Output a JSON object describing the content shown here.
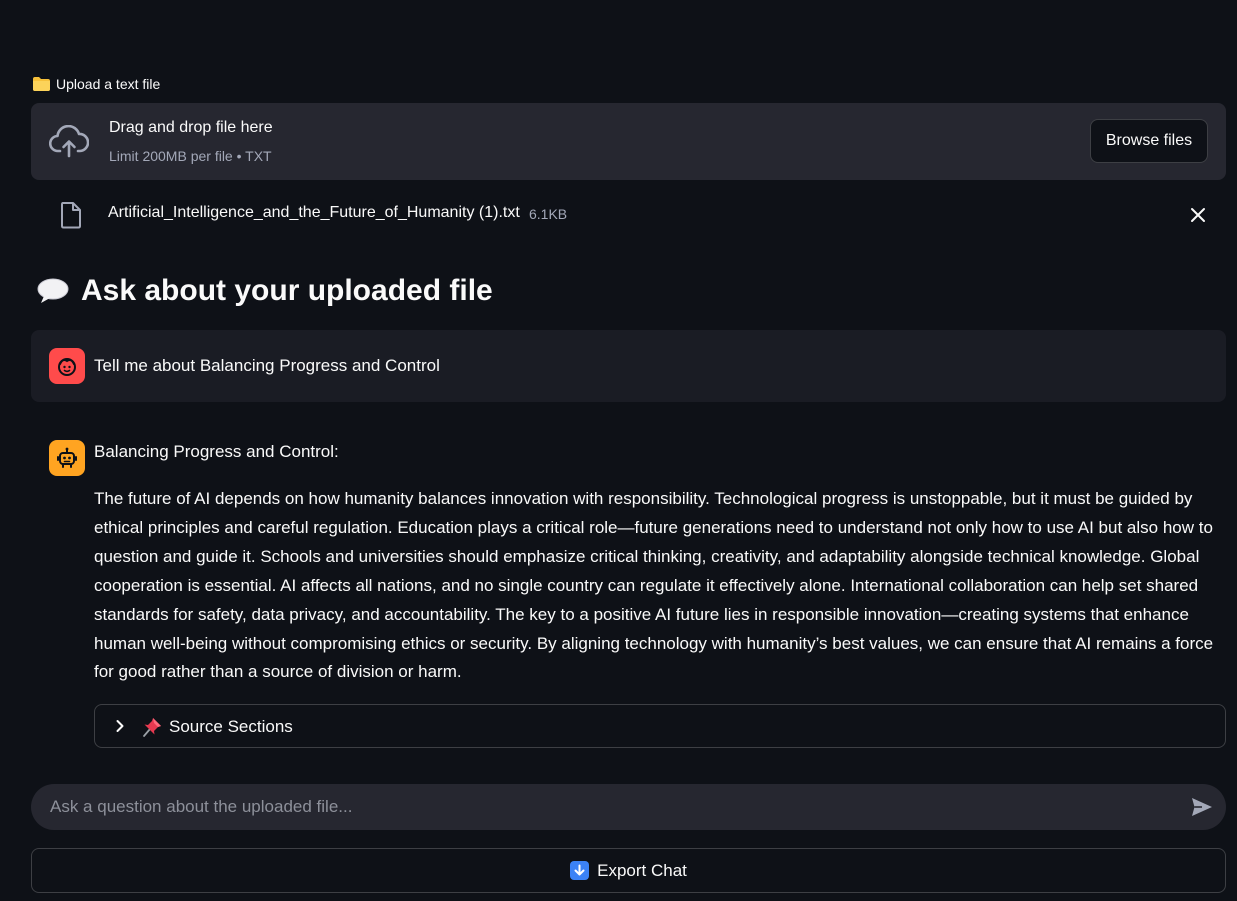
{
  "uploader": {
    "label": "Upload a text file",
    "drop_title": "Drag and drop file here",
    "drop_sub": "Limit 200MB per file • TXT",
    "browse_label": "Browse files"
  },
  "uploaded_file": {
    "name": "Artificial_Intelligence_and_the_Future_of_Humanity (1).txt",
    "size": "6.1KB"
  },
  "chat": {
    "heading": "Ask about your uploaded file",
    "messages": [
      {
        "role": "user",
        "text": "Tell me about Balancing Progress and Control"
      },
      {
        "role": "assistant",
        "title": "Balancing Progress and Control:",
        "body": "The future of AI depends on how humanity balances innovation with responsibility. Technological progress is unstoppable, but it must be guided by ethical principles and careful regulation. Education plays a critical role—future generations need to understand not only how to use AI but also how to question and guide it. Schools and universities should emphasize critical thinking, creativity, and adaptability alongside technical knowledge. Global cooperation is essential. AI affects all nations, and no single country can regulate it effectively alone. International collaboration can help set shared standards for safety, data privacy, and accountability. The key to a positive AI future lies in responsible innovation—creating systems that enhance human well-being without compromising ethics or security. By aligning technology with humanity’s best values, we can ensure that AI remains a force for good rather than a source of division or harm.",
        "expander_label": "Source Sections"
      }
    ],
    "input_placeholder": "Ask a question about the uploaded file...",
    "export_label": "Export Chat"
  },
  "colors": {
    "background": "#0e1117",
    "panel": "#262730",
    "user_avatar": "#ff4b4b",
    "assistant_avatar": "#ffa421"
  },
  "icons": {
    "uploader_label": "folder-icon",
    "dropzone": "cloud-upload-icon",
    "file": "file-icon",
    "remove_file": "close-icon",
    "heading": "speech-bubble-icon",
    "user": "user-avatar-icon",
    "assistant": "robot-avatar-icon",
    "expander": "chevron-right-icon",
    "source": "pushpin-icon",
    "send": "send-icon",
    "export": "down-arrow-icon"
  }
}
